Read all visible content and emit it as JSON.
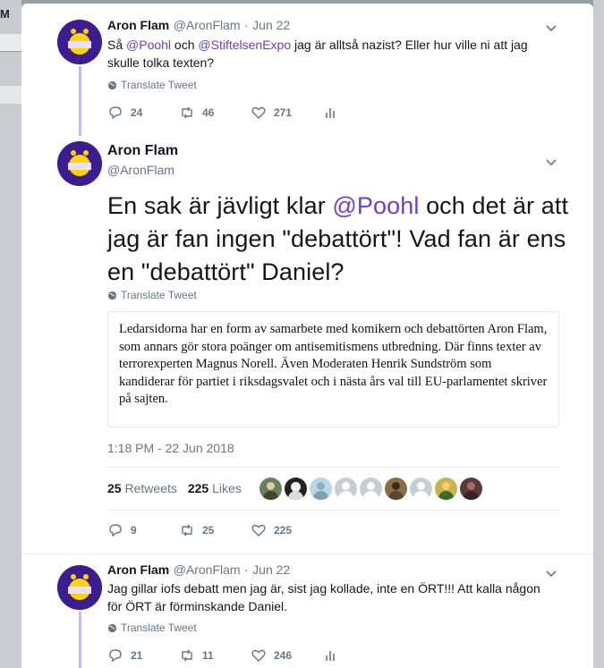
{
  "background": {
    "app_letter": "M"
  },
  "tweets": [
    {
      "name": "Aron Flam",
      "handle": "@AronFlam",
      "separator": "·",
      "date": "Jun 22",
      "text_parts": [
        "Så ",
        "@Poohl",
        " och ",
        "@StiftelsenExpo",
        " jag är alltså nazist? Eller hur ville ni att jag skulle tolka texten?"
      ],
      "translate": "Translate Tweet",
      "replies": "24",
      "retweets": "46",
      "likes": "271"
    },
    {
      "name": "Aron Flam",
      "handle": "@AronFlam",
      "text_parts": [
        "En sak är jävligt klar ",
        "@Poohl",
        " och det är att jag är fan ingen \"debattört\"! Vad fan är ens en \"debattört\" Daniel?"
      ],
      "translate": "Translate Tweet",
      "quote": "Ledarsidorna har en form av samarbete med komikern och debattörten Aron Flam, som annars gör stora poänger om antisemitismens utbredning. Där finns texter av terrorexperten Magnus Norell. Även Moderaten Henrik Sundström som kandiderar för partiet i riksdagsvalet och i nästa års val till EU-parlamentet skriver på sajten.",
      "timestamp": "1:18 PM - 22 Jun 2018",
      "retweet_count": "25",
      "retweet_label": "Retweets",
      "like_count": "225",
      "like_label": "Likes",
      "replies": "9",
      "retweets": "25",
      "likes": "225"
    },
    {
      "name": "Aron Flam",
      "handle": "@AronFlam",
      "separator": "·",
      "date": "Jun 22",
      "text": "Jag gillar iofs debatt men jag är, sist jag kollade, inte en ÖRT!!! Att kalla någon för ÖRT är förminskande Daniel.",
      "translate": "Translate Tweet",
      "replies": "21",
      "retweets": "11",
      "likes": "246"
    }
  ],
  "colors": {
    "accent": "#6b3fd1",
    "thread_line": "#c9b7f0",
    "muted": "#657786"
  },
  "icons": [
    "reply-icon",
    "retweet-icon",
    "like-icon",
    "analytics-icon",
    "globe-icon",
    "chevron-down-icon"
  ]
}
